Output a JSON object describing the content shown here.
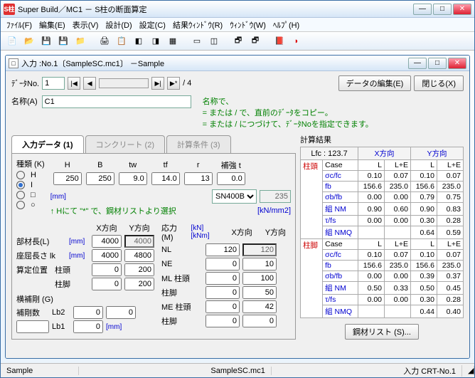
{
  "app": {
    "title": "Super Build／MC1 － S柱の断面算定",
    "icon": "S柱"
  },
  "menus": [
    "ﾌｧｲﾙ(F)",
    "編集(E)",
    "表示(V)",
    "設計(D)",
    "設定(C)",
    "結果ｳｨﾝﾄﾞｳ(R)",
    "ｳｨﾝﾄﾞｳ(W)",
    "ﾍﾙﾌﾟ(H)"
  ],
  "child": {
    "title": "入力 :No.1〔SampleSC.mc1〕 －Sample",
    "icon": "□"
  },
  "toprow": {
    "dataNo_label": "ﾃﾞｰﾀNo.",
    "dataNo": "1",
    "total": "/ 4",
    "editBtn": "データの編集(E)",
    "closeBtn": "閉じる(X)"
  },
  "nameRow": {
    "label": "名称(A)",
    "value": "C1"
  },
  "hints": {
    "l1": "名称で、",
    "l2": "= または / で、直前のﾃﾞｰﾀをコピー。",
    "l3": "= または / につづけて、ﾃﾞｰﾀNoを指定できます。"
  },
  "tabs": {
    "t1": "入力データ (1)",
    "t2": "コンクリート (2)",
    "t3": "計算条件 (3)"
  },
  "kind": {
    "label": "種類 (K)",
    "opts": [
      "H",
      "I",
      "□",
      "○"
    ],
    "selected": "I"
  },
  "sizes": {
    "hdr": [
      "H",
      "B",
      "tw",
      "tf",
      "r",
      "補強 t"
    ],
    "vals": [
      "250",
      "250",
      "9.0",
      "14.0",
      "13",
      "0.0"
    ],
    "unit": "[mm]"
  },
  "steel": {
    "select": "SN400B",
    "num": "235",
    "hint": "↑ Hにて \"*\" で、鋼材リストより選択",
    "unit": "[kN/mm2]"
  },
  "memLen": {
    "label": "部材長(L)",
    "unit": "[mm]",
    "xdir": "X方向",
    "ydir": "Y方向",
    "x": "4000",
    "y": "4000"
  },
  "zakutsu": {
    "label": "座屈長さ lk",
    "unit": "[mm]",
    "x": "4000",
    "y": "4800"
  },
  "santei": {
    "label": "算定位置",
    "top": "柱頭",
    "bot": "柱脚",
    "tx": "0",
    "ty": "200",
    "bx": "0",
    "by": "200"
  },
  "yokohogo": {
    "label": "横補剛 (G)",
    "row1": "補剛数",
    "Lb2": "Lb2",
    "Lb1": "Lb1",
    "v11": "0",
    "v12": "0",
    "v21": "",
    "v22": "0",
    "unit": "[mm]"
  },
  "stress": {
    "label": "応力 (M)",
    "unit": "[kN] [kNm]",
    "xdir": "X方向",
    "ydir": "Y方向",
    "rows": [
      {
        "n": "NL",
        "x": "120",
        "y": "120",
        "yRo": true
      },
      {
        "n": "NE",
        "x": "0",
        "y": "10"
      },
      {
        "n": "ML 柱頭",
        "x": "0",
        "y": "100"
      },
      {
        "n": "柱脚",
        "x": "0",
        "y": "50"
      },
      {
        "n": "ME 柱頭",
        "x": "0",
        "y": "42"
      },
      {
        "n": "柱脚",
        "x": "0",
        "y": "0"
      }
    ]
  },
  "results": {
    "title": "計算結果",
    "Lfc": "Lfc : ",
    "LfcV": "123.7",
    "Xdir": "X方向",
    "Ydir": "Y方向",
    "steelBtn": "鋼材リスト (S)...",
    "groups": [
      {
        "head": "柱頭",
        "rows": [
          {
            "n": "Case",
            "a": "L",
            "b": "L+E",
            "c": "L",
            "d": "L+E"
          },
          {
            "n": "σc/fc",
            "a": "0.10",
            "b": "0.07",
            "c": "0.10",
            "d": "0.07"
          },
          {
            "n": "fb",
            "a": "156.6",
            "b": "235.0",
            "c": "156.6",
            "d": "235.0"
          },
          {
            "n": "σb/fb",
            "a": "0.00",
            "b": "0.00",
            "c": "0.79",
            "d": "0.75"
          },
          {
            "n": "組 NM",
            "a": "0.90",
            "b": "0.60",
            "c": "0.90",
            "d": "0.83"
          },
          {
            "n": "τ/fs",
            "a": "0.00",
            "b": "0.00",
            "c": "0.30",
            "d": "0.28"
          },
          {
            "n": "組 NMQ",
            "a": "",
            "b": "",
            "c": "0.64",
            "d": "0.59"
          }
        ]
      },
      {
        "head": "柱脚",
        "rows": [
          {
            "n": "Case",
            "a": "L",
            "b": "L+E",
            "c": "L",
            "d": "L+E"
          },
          {
            "n": "σc/fc",
            "a": "0.10",
            "b": "0.07",
            "c": "0.10",
            "d": "0.07"
          },
          {
            "n": "fb",
            "a": "156.6",
            "b": "235.0",
            "c": "156.6",
            "d": "235.0"
          },
          {
            "n": "σb/fb",
            "a": "0.00",
            "b": "0.00",
            "c": "0.39",
            "d": "0.37"
          },
          {
            "n": "組 NM",
            "a": "0.50",
            "b": "0.33",
            "c": "0.50",
            "d": "0.45"
          },
          {
            "n": "τ/fs",
            "a": "0.00",
            "b": "0.00",
            "c": "0.30",
            "d": "0.28"
          },
          {
            "n": "組 NMQ",
            "a": "",
            "b": "",
            "c": "0.44",
            "d": "0.40"
          }
        ]
      }
    ]
  },
  "status": {
    "s1": "Sample",
    "s2": "SampleSC.mc1",
    "s3": "入力 CRT-No.1"
  }
}
